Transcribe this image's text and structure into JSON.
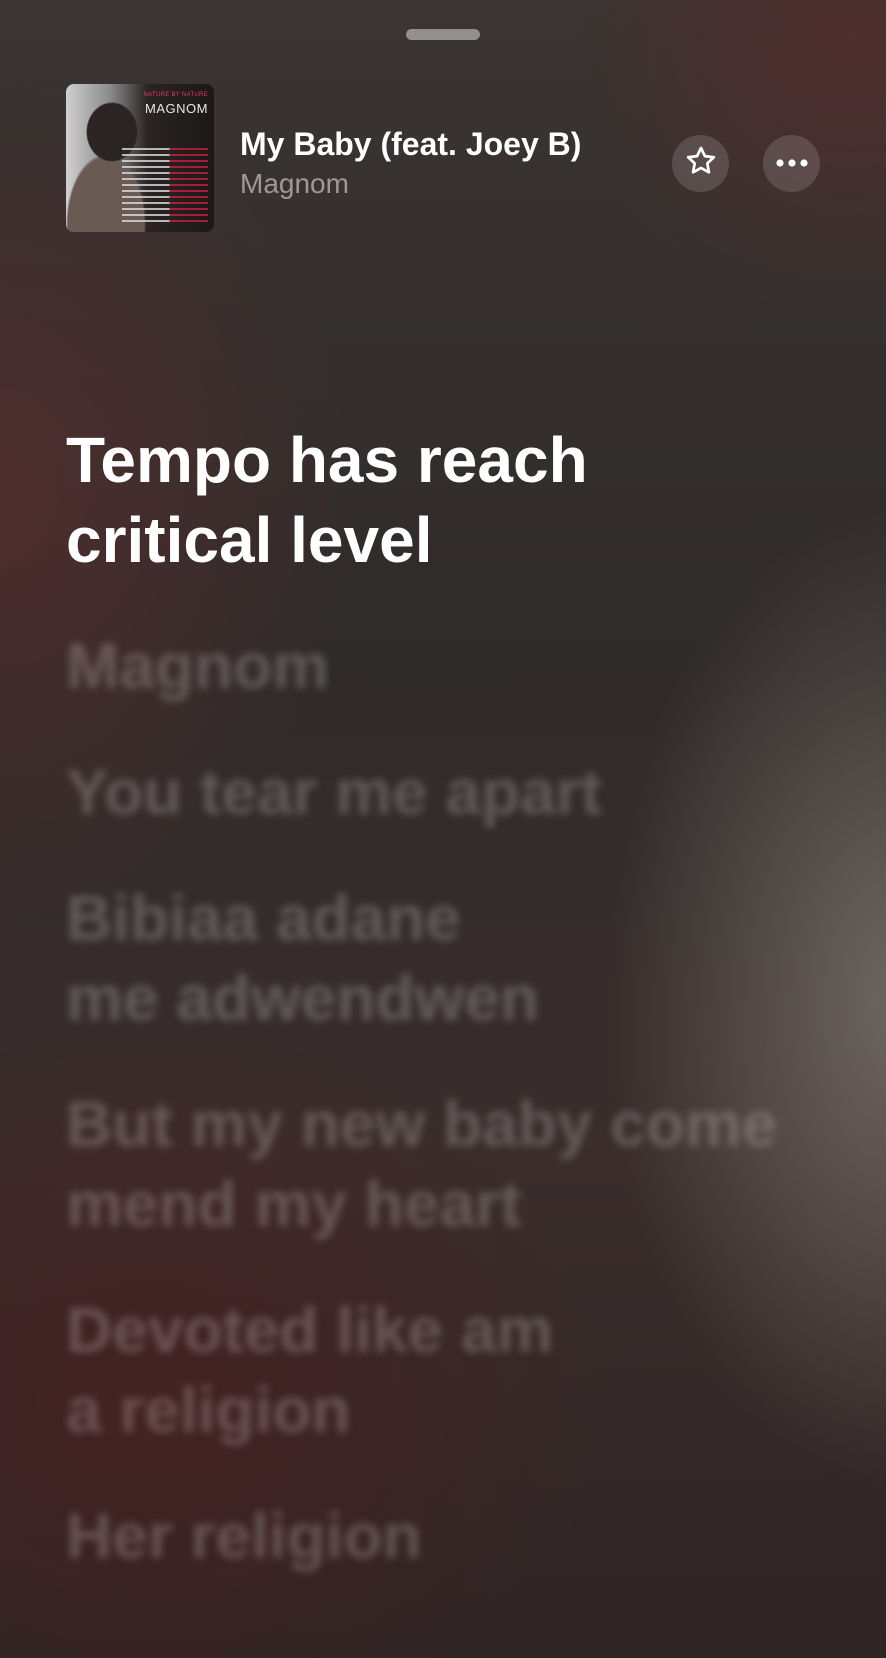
{
  "now_playing": {
    "title": "My Baby (feat. Joey B)",
    "artist": "Magnom",
    "album_art": {
      "brand": "MAGNOM",
      "label": "NATURE BY NATURE"
    }
  },
  "icons": {
    "grabber": "sheet-grabber",
    "favorite": "star-outline-icon",
    "more": "ellipsis-icon"
  },
  "lyrics": {
    "active": [
      "Tempo has reach",
      "critical level"
    ],
    "upcoming": [
      [
        "Magnom"
      ],
      [
        "You tear me apart"
      ],
      [
        "Bibiaa adane",
        "me adwendwen"
      ],
      [
        "But my new baby come",
        "mend my heart"
      ],
      [
        "Devoted like am",
        "a religion"
      ],
      [
        "Her religion"
      ]
    ]
  },
  "colors": {
    "text_primary": "#ffffff",
    "text_secondary": "rgba(255,255,255,0.5)",
    "button_bg": "rgba(255,255,255,0.14)"
  }
}
